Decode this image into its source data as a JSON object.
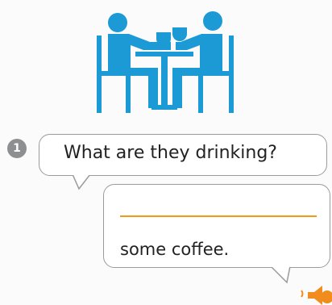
{
  "exercise": {
    "number": "1",
    "question": "What are they drinking?",
    "answer_prefix": "",
    "answer_suffix": "some coffee."
  },
  "colors": {
    "illustration": "#1b9ad6",
    "answer_line": "#f29a17",
    "audio_icon": "#f28c1e"
  },
  "icons": {
    "illustration": "two-people-drinking-coffee-icon",
    "audio": "speaker-icon"
  }
}
